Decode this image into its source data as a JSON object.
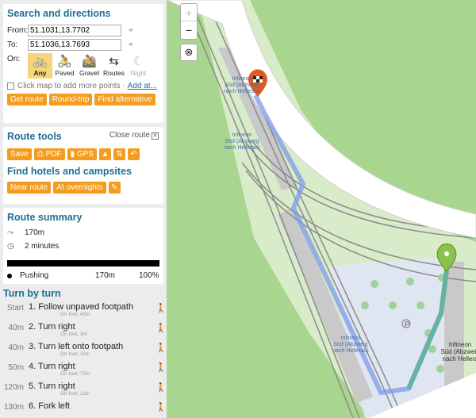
{
  "search": {
    "title": "Search and directions",
    "from_label": "From:",
    "from_value": "51.1031,13.7702",
    "to_label": "To:",
    "to_value": "51.1036,13.7693",
    "on_label": "On:",
    "types": [
      {
        "label": "Any",
        "icon": "bike-icon",
        "selected": true
      },
      {
        "label": "Paved",
        "icon": "road-bike-icon",
        "selected": false
      },
      {
        "label": "Gravel",
        "icon": "gravel-bike-icon",
        "selected": false
      },
      {
        "label": "Routes",
        "icon": "signpost-icon",
        "selected": false
      },
      {
        "label": "Night",
        "icon": "moon-icon",
        "selected": false
      }
    ],
    "click_map_text": "Click map to add more points ·",
    "add_at_link": "Add at...",
    "buttons": {
      "get_route": "Get route",
      "round_trip": "Round-trip",
      "find_alt": "Find alternative"
    }
  },
  "route_tools": {
    "title": "Route tools",
    "close_label": "Close route",
    "save": "Save",
    "pdf": "PDF",
    "gps": "GPS"
  },
  "hotels": {
    "title": "Find hotels and campsites",
    "near_route": "Near route",
    "at_overnights": "At overnights"
  },
  "summary": {
    "title": "Route summary",
    "distance": "170m",
    "time": "2 minutes",
    "legend_label": "Pushing",
    "legend_distance": "170m",
    "legend_percent": "100%"
  },
  "turns": {
    "title": "Turn by turn",
    "items": [
      {
        "dist": "Start",
        "text": "1. Follow unpaved footpath",
        "sub": "On foot, 40m"
      },
      {
        "dist": "40m",
        "text": "2. Turn right",
        "sub": "On foot, 3m"
      },
      {
        "dist": "40m",
        "text": "3. Turn left onto footpath",
        "sub": "On foot, 11m"
      },
      {
        "dist": "50m",
        "text": "4. Turn right",
        "sub": "On foot, 70m"
      },
      {
        "dist": "120m",
        "text": "5. Turn right",
        "sub": "On foot, 11m"
      },
      {
        "dist": "130m",
        "text": "6. Fork left",
        "sub": ""
      }
    ]
  },
  "map": {
    "zoom_in": "+",
    "zoom_out": "−",
    "stop_label_1": [
      "Infineon",
      "Süd (Abzweig",
      "nach Hellerau)"
    ],
    "stop_label_2": [
      "Infineon",
      "Süd (Abzweig",
      "nach Hellerau)"
    ],
    "stop_label_3": [
      "Infineon",
      "Süd (Abzweig",
      "nach Hellerau)"
    ],
    "stop_label_4": [
      "Infineon",
      "Süd (Abzweig",
      "nach Hellera"
    ],
    "colors": {
      "grass": "#a8d68f",
      "road": "#ffffff",
      "route": "#7f9bea",
      "route_start": "#5fb49a"
    }
  }
}
